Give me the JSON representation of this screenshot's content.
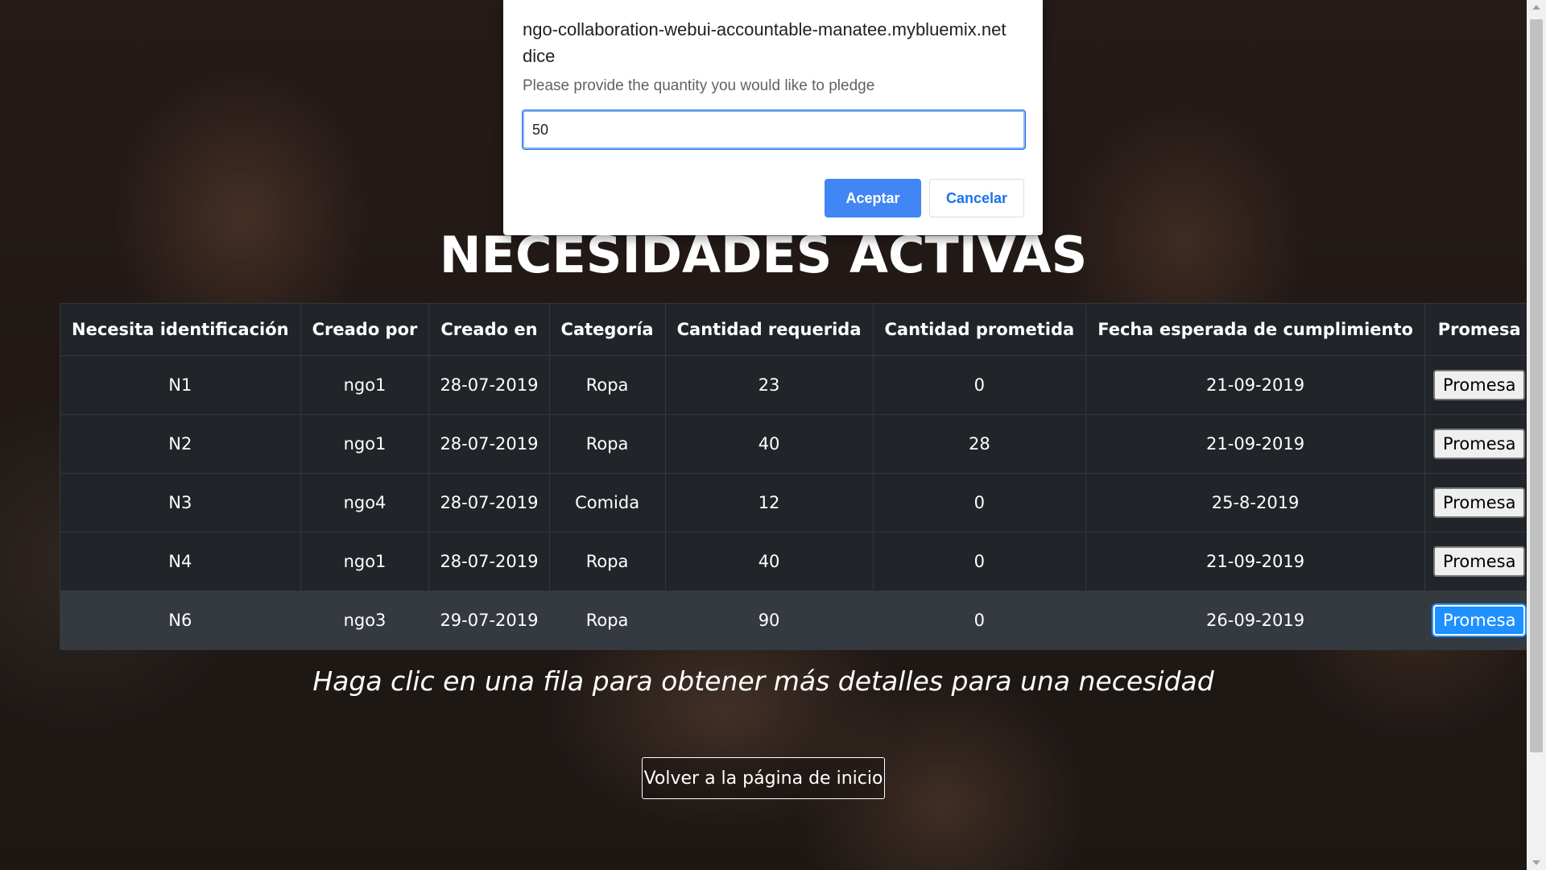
{
  "dialog": {
    "title": "ngo-collaboration-webui-accountable-manatee.mybluemix.net dice",
    "message": "Please provide the quantity you would like to pledge",
    "input_value": "50",
    "accept_label": "Aceptar",
    "cancel_label": "Cancelar"
  },
  "page": {
    "heading": "NECESIDADES ACTIVAS",
    "hint": "Haga clic en una fila para obtener más detalles para una necesidad",
    "home_button": "Volver a la página de inicio"
  },
  "table": {
    "headers": [
      "Necesita identificación",
      "Creado por",
      "Creado en",
      "Categoría",
      "Cantidad requerida",
      "Cantidad prometida",
      "Fecha esperada de cumplimiento",
      "Promesa"
    ],
    "button_label": "Promesa",
    "rows": [
      {
        "id": "N1",
        "created_by": "ngo1",
        "created_on": "28-07-2019",
        "category": "Ropa",
        "required": "23",
        "pledged": "0",
        "expected_date": "21-09-2019"
      },
      {
        "id": "N2",
        "created_by": "ngo1",
        "created_on": "28-07-2019",
        "category": "Ropa",
        "required": "40",
        "pledged": "28",
        "expected_date": "21-09-2019"
      },
      {
        "id": "N3",
        "created_by": "ngo4",
        "created_on": "28-07-2019",
        "category": "Comida",
        "required": "12",
        "pledged": "0",
        "expected_date": "25-8-2019"
      },
      {
        "id": "N4",
        "created_by": "ngo1",
        "created_on": "28-07-2019",
        "category": "Ropa",
        "required": "40",
        "pledged": "0",
        "expected_date": "21-09-2019"
      },
      {
        "id": "N6",
        "created_by": "ngo3",
        "created_on": "29-07-2019",
        "category": "Ropa",
        "required": "90",
        "pledged": "0",
        "expected_date": "26-09-2019"
      }
    ]
  },
  "colors": {
    "table_bg": "#212529",
    "active_row_bg": "#343a40",
    "accept_button": "#4285f4",
    "focused_pledge_button": "#1e90ff"
  }
}
